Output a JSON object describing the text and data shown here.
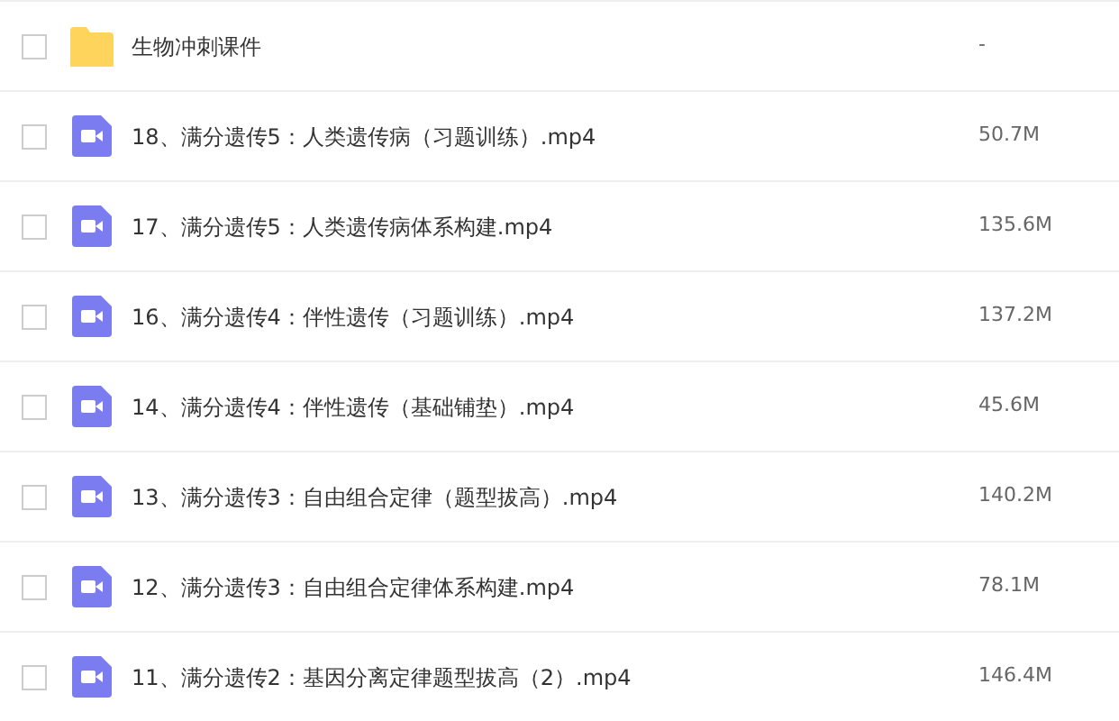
{
  "files": [
    {
      "kind": "folder",
      "name": "生物冲刺课件",
      "size": "-",
      "checked": false
    },
    {
      "kind": "video",
      "name": "18、满分遗传5：人类遗传病（习题训练）.mp4",
      "size": "50.7M",
      "checked": false
    },
    {
      "kind": "video",
      "name": "17、满分遗传5：人类遗传病体系构建.mp4",
      "size": "135.6M",
      "checked": false
    },
    {
      "kind": "video",
      "name": "16、满分遗传4：伴性遗传（习题训练）.mp4",
      "size": "137.2M",
      "checked": false
    },
    {
      "kind": "video",
      "name": "14、满分遗传4：伴性遗传（基础铺垫）.mp4",
      "size": "45.6M",
      "checked": false
    },
    {
      "kind": "video",
      "name": "13、满分遗传3：自由组合定律（题型拔高）.mp4",
      "size": "140.2M",
      "checked": false
    },
    {
      "kind": "video",
      "name": "12、满分遗传3：自由组合定律体系构建.mp4",
      "size": "78.1M",
      "checked": false
    },
    {
      "kind": "video",
      "name": "11、满分遗传2：基因分离定律题型拔高（2）.mp4",
      "size": "146.4M",
      "checked": false
    }
  ]
}
